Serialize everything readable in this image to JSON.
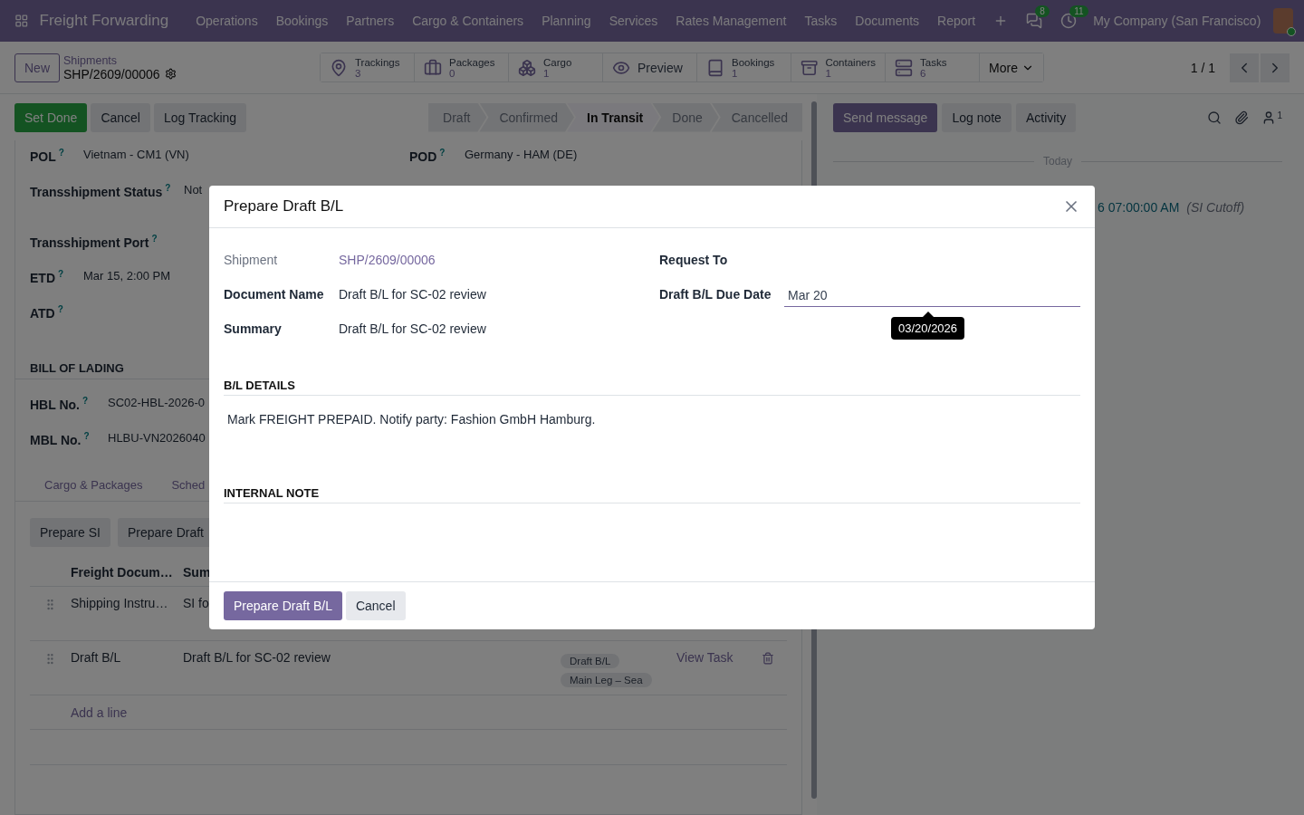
{
  "navbar": {
    "app": "Freight Forwarding",
    "menus": [
      "Operations",
      "Bookings",
      "Partners",
      "Cargo & Containers",
      "Planning",
      "Services",
      "Rates Management",
      "Tasks",
      "Documents",
      "Report"
    ],
    "messages_badge": "8",
    "activities_badge": "11",
    "company": "My Company (San Francisco)"
  },
  "control_panel": {
    "new_button": "New",
    "breadcrumb": "Shipments",
    "record": "SHP/2609/00006",
    "smart_buttons": [
      {
        "kind": "stat",
        "label": "Trackings",
        "value": "3"
      },
      {
        "kind": "stat",
        "label": "Packages",
        "value": "0"
      },
      {
        "kind": "stat",
        "label": "Cargo",
        "value": "1"
      },
      {
        "kind": "action",
        "label": "Preview"
      },
      {
        "kind": "stat",
        "label": "Bookings",
        "value": "1"
      },
      {
        "kind": "stat",
        "label": "Containers",
        "value": "1"
      },
      {
        "kind": "stat",
        "label": "Tasks",
        "value": "6"
      },
      {
        "kind": "more",
        "label": "More"
      }
    ],
    "pager": "1 / 1"
  },
  "actions": [
    {
      "kind": "primary",
      "label": "Set Done"
    },
    {
      "kind": "secondary",
      "label": "Cancel"
    },
    {
      "kind": "secondary",
      "label": "Log Tracking"
    }
  ],
  "status_bar": [
    {
      "label": "Draft",
      "selected": false
    },
    {
      "label": "Confirmed",
      "selected": false
    },
    {
      "label": "In Transit",
      "selected": true
    },
    {
      "label": "Done",
      "selected": false
    },
    {
      "label": "Cancelled",
      "selected": false
    }
  ],
  "form": {
    "left_fields": [
      {
        "label": "POL",
        "help": "?",
        "value": "Vietnam - CM1 (VN)"
      },
      {
        "label": "Transshipment Status",
        "help": "?",
        "value": "Not"
      },
      {
        "label": "Transshipment Port",
        "help": "?"
      },
      {
        "label": "ETD",
        "help": "?",
        "value": "Mar 15, 2:00 PM"
      },
      {
        "label": "ATD",
        "help": "?"
      }
    ],
    "right_fields": [
      {
        "label": "POD",
        "help": "?",
        "value": "Germany - HAM (DE)"
      }
    ],
    "bill_of_lading": {
      "title": "BILL OF LADING",
      "fields": [
        {
          "label": "HBL No.",
          "help": "?",
          "value": "SC02-HBL-2026-0"
        },
        {
          "label": "MBL No.",
          "help": "?",
          "value": "HLBU-VN2026040"
        }
      ]
    },
    "tabs": [
      "Cargo & Packages",
      "Sched"
    ],
    "list_buttons": [
      "Prepare SI",
      "Prepare Draft"
    ],
    "table": {
      "columns": [
        "Freight Docum…",
        "Sum"
      ],
      "rows": [
        {
          "document": "Shipping Instru…",
          "summary": "SI fo"
        },
        {
          "document": "Draft B/L",
          "summary": "Draft B/L for SC-02 review",
          "tags": [
            "Draft B/L",
            "Main Leg – Sea"
          ],
          "action": "View Task"
        }
      ],
      "add_line": "Add a line"
    }
  },
  "chatter": {
    "buttons": [
      {
        "kind": "primary",
        "label": "Send message"
      },
      {
        "kind": "secondary",
        "label": "Log note"
      },
      {
        "kind": "secondary",
        "label": "Activity"
      }
    ],
    "followers": "1",
    "date_divider": "Today",
    "activity": {
      "date": "6 07:00:00 AM",
      "note": "(SI Cutoff)"
    }
  },
  "dialog": {
    "title": "Prepare Draft B/L",
    "left_fields": [
      {
        "kind": "link",
        "label": "Shipment",
        "value": "SHP/2609/00006"
      },
      {
        "kind": "text",
        "label": "Document Name",
        "value": "Draft B/L for SC-02 review"
      },
      {
        "kind": "text",
        "label": "Summary",
        "value": "Draft B/L for SC-02 review"
      }
    ],
    "right_fields": [
      {
        "kind": "text",
        "label": "Request To"
      },
      {
        "kind": "date",
        "label": "Draft B/L Due Date",
        "value": "Mar 20",
        "tooltip": "03/20/2026"
      }
    ],
    "sections": [
      {
        "title": "B/L DETAILS",
        "text": "Mark FREIGHT PREPAID. Notify party: Fashion GmbH Hamburg."
      },
      {
        "title": "INTERNAL NOTE"
      }
    ],
    "buttons": [
      {
        "kind": "primary",
        "label": "Prepare Draft B/L"
      },
      {
        "kind": "secondary",
        "label": "Cancel"
      }
    ]
  }
}
